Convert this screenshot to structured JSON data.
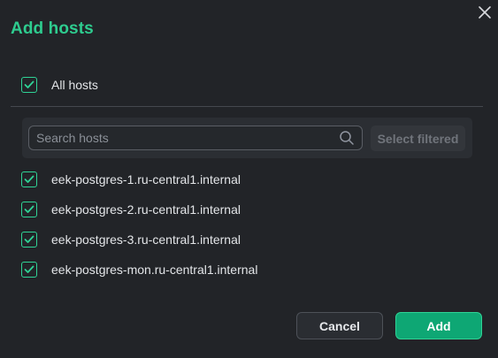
{
  "dialog": {
    "title": "Add hosts",
    "close_icon": "close-icon"
  },
  "all_hosts": {
    "label": "All hosts",
    "checked": true
  },
  "search": {
    "placeholder": "Search hosts",
    "value": "",
    "icon": "search-icon",
    "select_filtered_label": "Select filtered"
  },
  "hosts": [
    {
      "label": "eek-postgres-1.ru-central1.internal",
      "checked": true
    },
    {
      "label": "eek-postgres-2.ru-central1.internal",
      "checked": true
    },
    {
      "label": "eek-postgres-3.ru-central1.internal",
      "checked": true
    },
    {
      "label": "eek-postgres-mon.ru-central1.internal",
      "checked": true
    }
  ],
  "footer": {
    "cancel_label": "Cancel",
    "add_label": "Add"
  },
  "colors": {
    "accent": "#2ecc8f",
    "primary_button": "#0ea774",
    "background": "#222428"
  }
}
